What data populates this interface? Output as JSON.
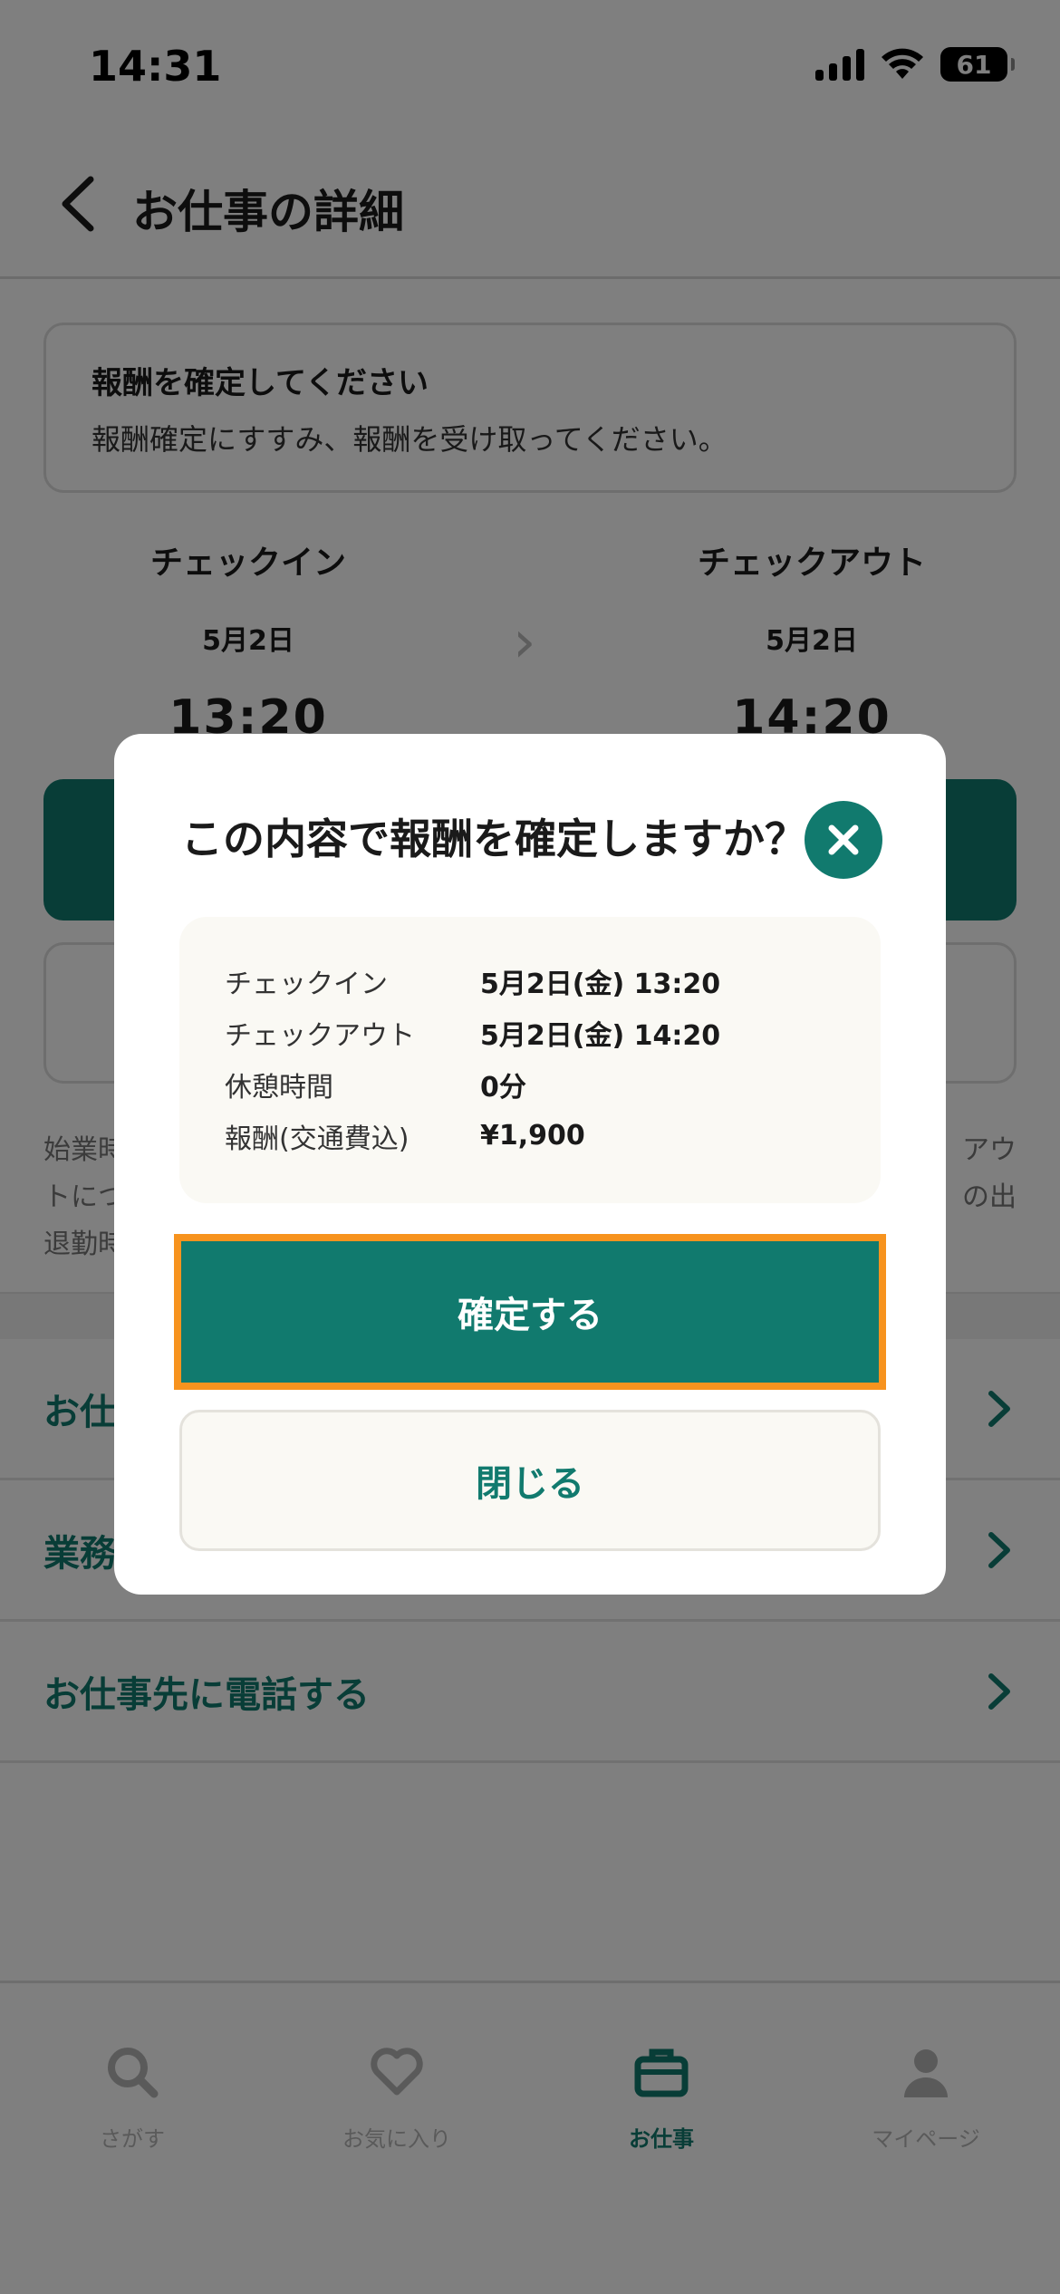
{
  "status_bar": {
    "time": "14:31",
    "battery": "61"
  },
  "header": {
    "title": "お仕事の詳細"
  },
  "notice": {
    "title": "報酬を確定してください",
    "body": "報酬確定にすすみ、報酬を受け取ってください。"
  },
  "checkin": {
    "label": "チェックイン",
    "date": "5月2日",
    "time": "13:20"
  },
  "checkout": {
    "label": "チェックアウト",
    "date": "5月2日",
    "time": "14:20"
  },
  "background_note": {
    "line1_start": "始業時",
    "line1_end": "アウ",
    "line2_start": "トにつ",
    "line2_end": "の出",
    "line3_start": "退勤時"
  },
  "menu": {
    "row1": "お仕",
    "row2": "業務",
    "row3": "お仕事先に電話する"
  },
  "tabs": [
    {
      "label": "さがす",
      "icon": "search-icon"
    },
    {
      "label": "お気に入り",
      "icon": "heart-icon"
    },
    {
      "label": "お仕事",
      "icon": "briefcase-icon"
    },
    {
      "label": "マイページ",
      "icon": "person-icon"
    }
  ],
  "modal": {
    "title": "この内容で報酬を確定しますか？",
    "rows": [
      {
        "key": "チェックイン",
        "value": "5月2日(金) 13:20"
      },
      {
        "key": "チェックアウト",
        "value": "5月2日(金) 14:20"
      },
      {
        "key": "休憩時間",
        "value": "0分"
      },
      {
        "key": "報酬(交通費込)",
        "value": "¥1,900"
      }
    ],
    "confirm_label": "確定する",
    "close_label": "閉じる"
  },
  "colors": {
    "brand": "#117a6e",
    "highlight": "#f7931e",
    "overlay": "rgba(0,0,0,0.5)"
  }
}
